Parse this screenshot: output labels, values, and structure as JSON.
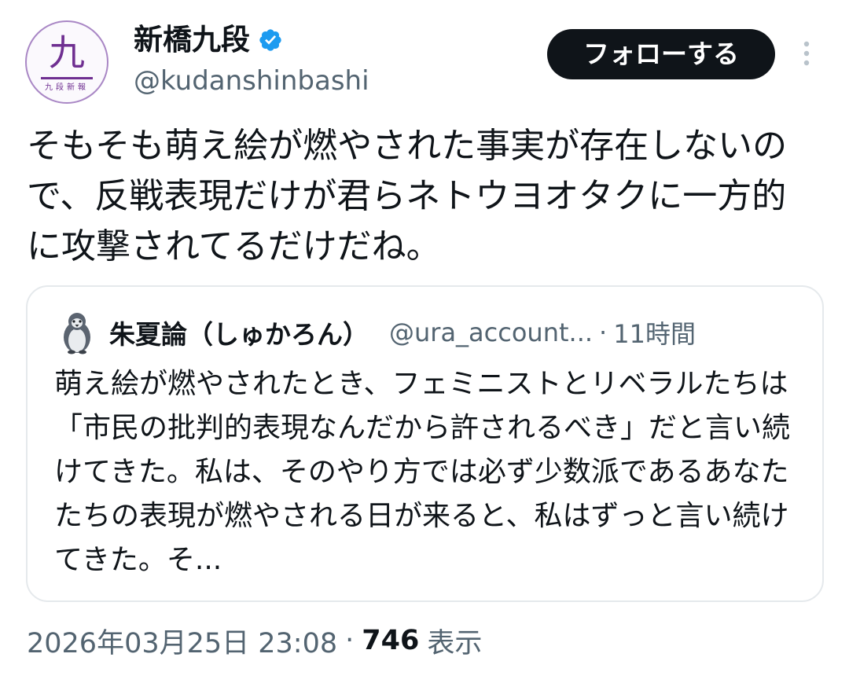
{
  "author": {
    "display_name": "新橋九段",
    "handle": "@kudanshinbashi",
    "verified": true,
    "avatar": {
      "glyph": "九",
      "subtext": "九段新報",
      "color": "#6f2f91"
    }
  },
  "actions": {
    "follow_label": "フォローする",
    "more_icon": "more-vertical-icon"
  },
  "tweet": {
    "text": "そもそも萌え絵が燃やされた事実が存在しないので、反戦表現だけが君らネトウヨオタクに一方的に攻撃されてるだけだね。"
  },
  "quote": {
    "avatar_icon": "penguin-avatar-icon",
    "display_name": "朱夏論（しゅかろん）",
    "handle": "@ura_account...",
    "separator": "·",
    "time": "11時間",
    "text": "萌え絵が燃やされたとき、フェミニストとリベラルたちは「市民の批判的表現なんだから許されるべき」だと言い続けてきた。私は、そのやり方では必ず少数派であるあなたたちの表現が燃やされる日が来ると、私はずっと言い続けてきた。そ..."
  },
  "meta": {
    "timestamp": "2026年03月25日 23:08",
    "separator": "·",
    "view_count": "746",
    "view_label": "表示"
  },
  "colors": {
    "text_primary": "#0f1419",
    "text_secondary": "#536471",
    "verified_blue": "#1d9bf0",
    "border": "#e5e9ec",
    "button_bg": "#0f1419"
  }
}
